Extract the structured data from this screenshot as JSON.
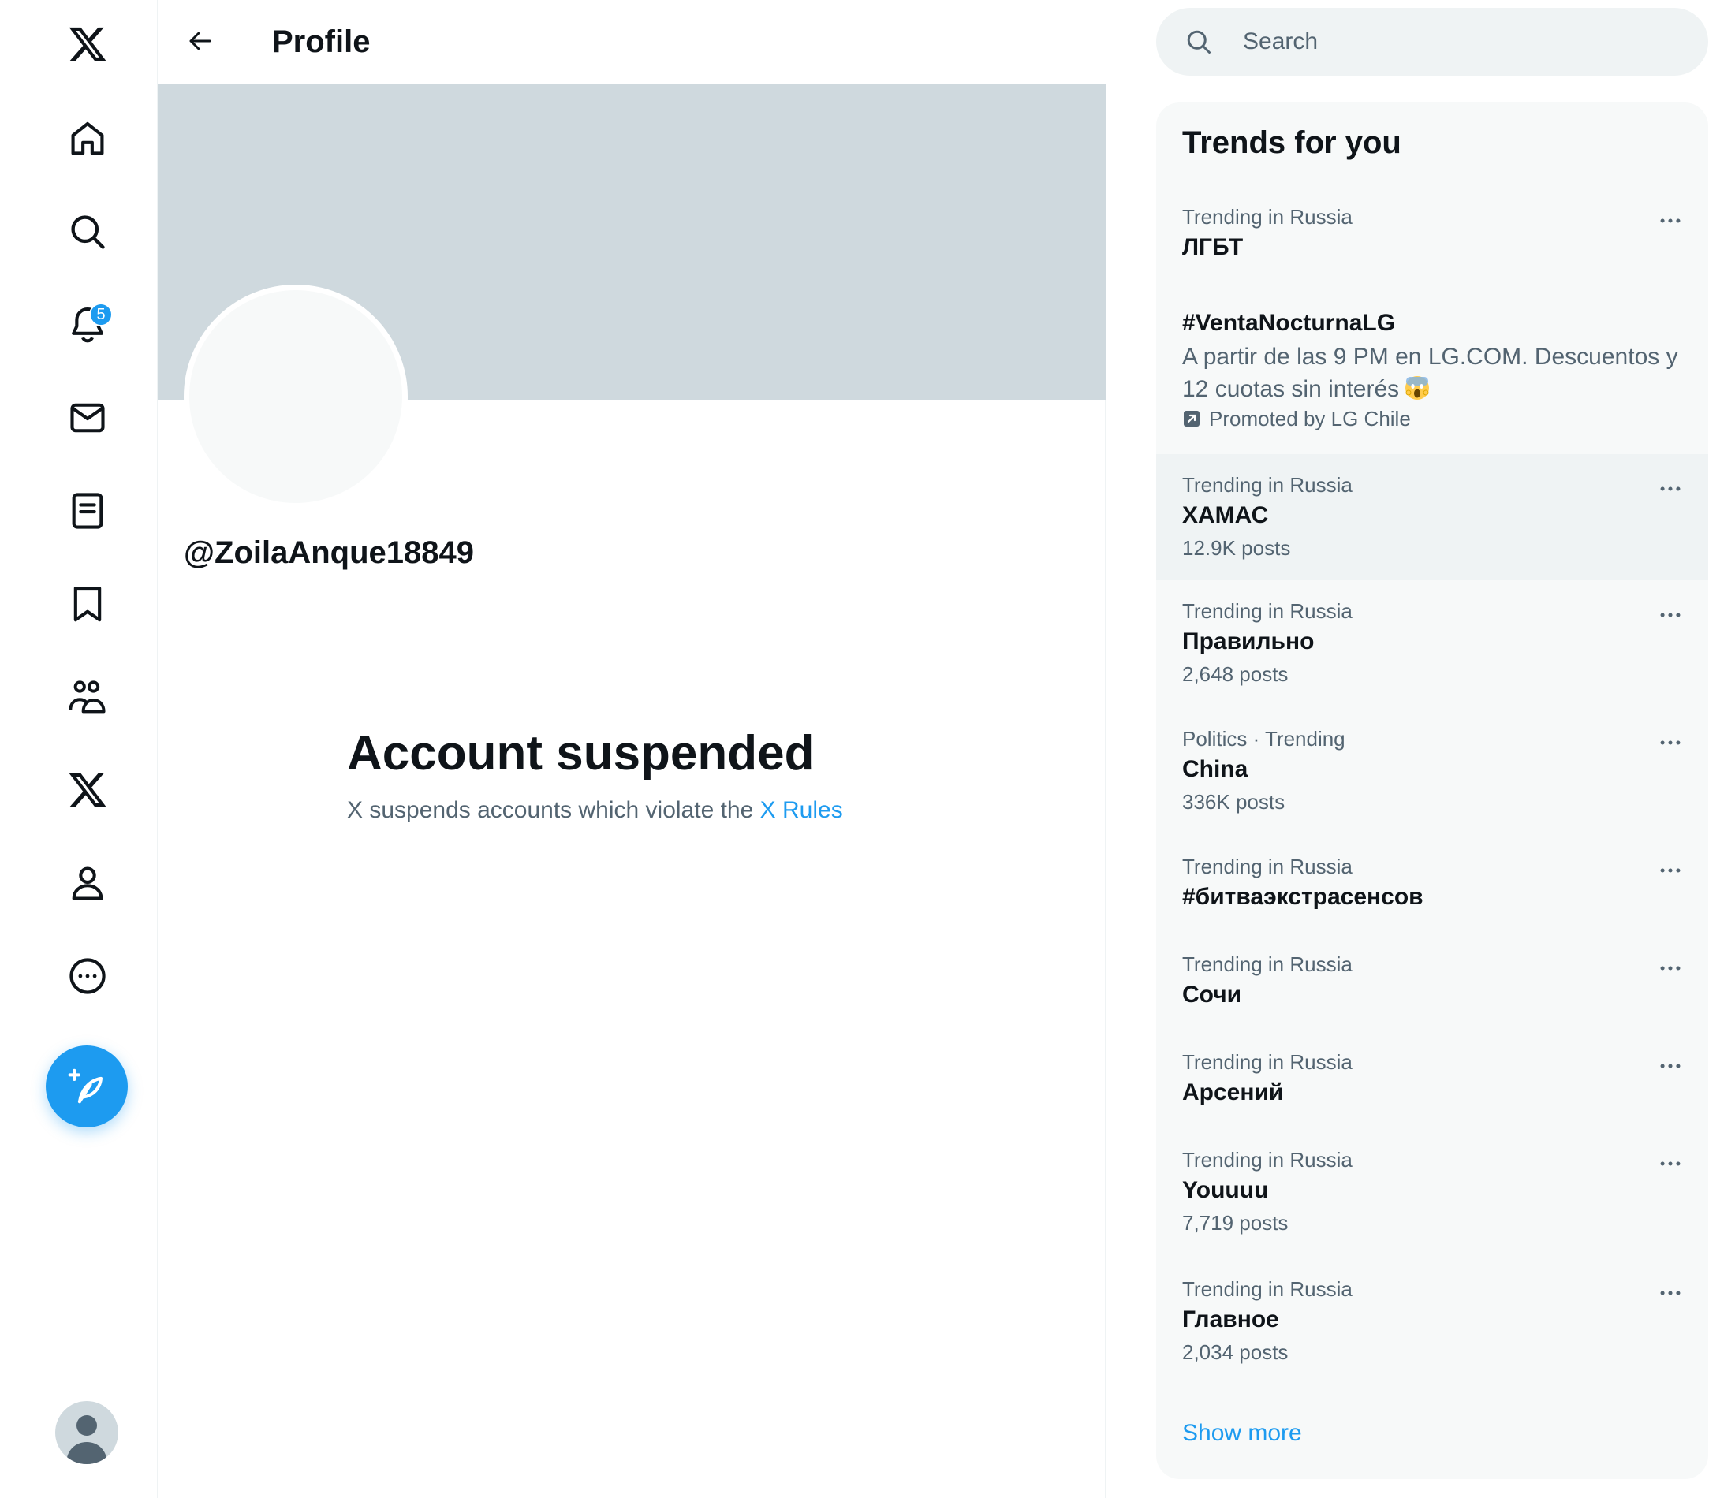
{
  "nav": {
    "notifications_badge": "5",
    "icons": [
      "x-logo-icon",
      "home-icon",
      "search-icon",
      "bell-icon",
      "mail-icon",
      "lists-icon",
      "bookmark-icon",
      "communities-icon",
      "x-premium-icon",
      "profile-icon",
      "more-circle-icon"
    ],
    "compose_icon": "compose-feather-icon",
    "accent": "#1d9bf0"
  },
  "header": {
    "title": "Profile"
  },
  "profile": {
    "handle": "@ZoilaAnque18849"
  },
  "suspended": {
    "title": "Account suspended",
    "message": "X suspends accounts which violate the",
    "link": "X Rules"
  },
  "search": {
    "placeholder": "Search"
  },
  "trends": {
    "title": "Trends for you",
    "items": [
      {
        "meta": "Trending in Russia",
        "name": "ЛГБТ",
        "count": ""
      },
      {
        "name": "#VentaNocturnaLG",
        "description": "A partir de las 9 PM en LG.COM. Descuentos y 12 cuotas sin interés",
        "promoted": "Promoted by LG Chile"
      },
      {
        "meta": "Trending in Russia",
        "name": "ХАМАС",
        "count": "12.9K posts"
      },
      {
        "meta": "Trending in Russia",
        "name": "Правильно",
        "count": "2,648 posts"
      },
      {
        "meta": "Politics · Trending",
        "name": "China",
        "count": "336K posts"
      },
      {
        "meta": "Trending in Russia",
        "name": "#битваэкстрасенсов",
        "count": ""
      },
      {
        "meta": "Trending in Russia",
        "name": "Сочи",
        "count": ""
      },
      {
        "meta": "Trending in Russia",
        "name": "Арсений",
        "count": ""
      },
      {
        "meta": "Trending in Russia",
        "name": "Youuuu",
        "count": "7,719 posts"
      },
      {
        "meta": "Trending in Russia",
        "name": "Главное",
        "count": "2,034 posts"
      }
    ],
    "show_more": "Show more"
  }
}
